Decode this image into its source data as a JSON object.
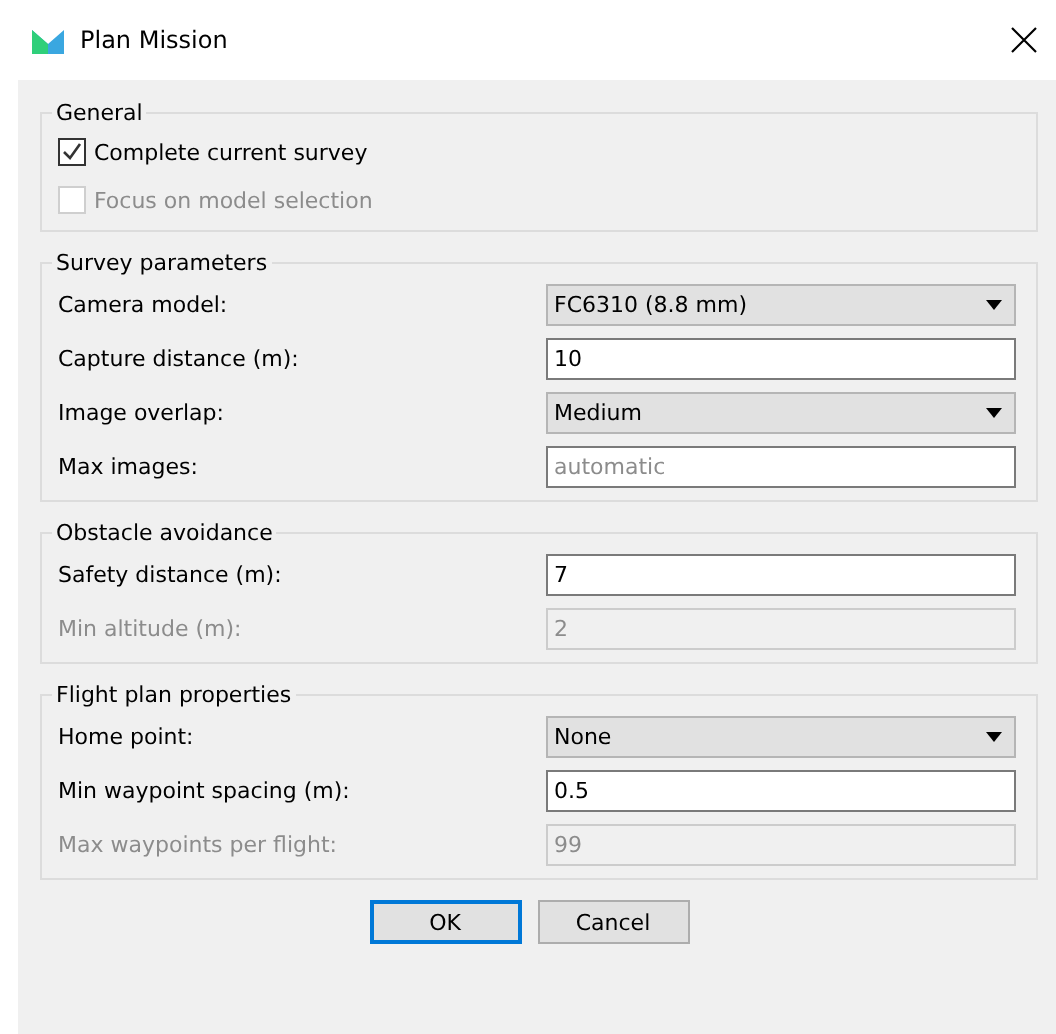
{
  "window": {
    "title": "Plan Mission"
  },
  "groups": [
    {
      "title": "General",
      "rows": [
        {
          "kind": "checkbox",
          "label": "Complete current survey",
          "checked": true,
          "disabled": false
        },
        {
          "kind": "checkbox",
          "label": "Focus on model selection",
          "checked": false,
          "disabled": true
        }
      ]
    },
    {
      "title": "Survey parameters",
      "rows": [
        {
          "kind": "select",
          "label": "Camera model:",
          "value": "FC6310 (8.8 mm)",
          "disabled": false
        },
        {
          "kind": "input",
          "label": "Capture distance (m):",
          "value": "10",
          "disabled": false
        },
        {
          "kind": "select",
          "label": "Image overlap:",
          "value": "Medium",
          "disabled": false
        },
        {
          "kind": "input",
          "label": "Max images:",
          "placeholder": "automatic",
          "disabled": false
        }
      ]
    },
    {
      "title": "Obstacle avoidance",
      "rows": [
        {
          "kind": "input",
          "label": "Safety distance (m):",
          "value": "7",
          "disabled": false
        },
        {
          "kind": "input",
          "label": "Min altitude (m):",
          "value": "2",
          "disabled": true
        }
      ]
    },
    {
      "title": "Flight plan properties",
      "rows": [
        {
          "kind": "select",
          "label": "Home point:",
          "value": "None",
          "disabled": false
        },
        {
          "kind": "input",
          "label": "Min waypoint spacing (m):",
          "value": "0.5",
          "disabled": false
        },
        {
          "kind": "input",
          "label": "Max waypoints per flight:",
          "value": "99",
          "disabled": true
        }
      ]
    }
  ],
  "buttons": [
    {
      "label": "OK",
      "default": true
    },
    {
      "label": "Cancel",
      "default": false
    }
  ]
}
